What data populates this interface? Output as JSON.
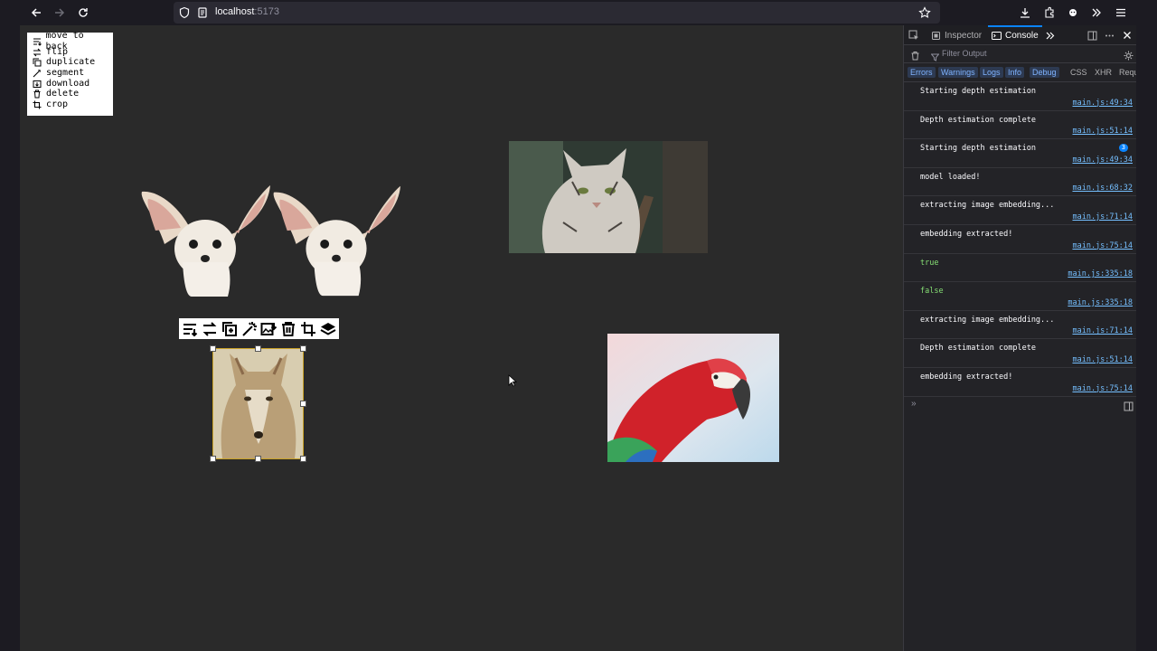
{
  "browser": {
    "url_host": "localhost",
    "url_port": ":5173"
  },
  "context_menu": {
    "items": [
      {
        "label": "move to back",
        "icon": "move-to-back-icon"
      },
      {
        "label": "flip",
        "icon": "flip-icon"
      },
      {
        "label": "duplicate",
        "icon": "duplicate-icon"
      },
      {
        "label": "segment",
        "icon": "segment-wand-icon"
      },
      {
        "label": "download",
        "icon": "download-icon"
      },
      {
        "label": "delete",
        "icon": "trash-icon"
      },
      {
        "label": "crop",
        "icon": "crop-icon"
      }
    ]
  },
  "selection_toolbar": {
    "tools": [
      "move-to-back-icon",
      "flip-icon",
      "duplicate-icon",
      "segment-wand-icon",
      "download-icon",
      "trash-icon",
      "crop-icon",
      "layers-icon"
    ]
  },
  "canvas": {
    "images": [
      "fennec-fox-1",
      "fennec-fox-2",
      "bobcat",
      "coyote",
      "macaw-parrot"
    ]
  },
  "devtools": {
    "tabs": {
      "inspector": "Inspector",
      "console": "Console"
    },
    "filter_placeholder": "Filter Output",
    "levels": [
      "Errors",
      "Warnings",
      "Logs",
      "Info",
      "Debug"
    ],
    "extra_filters": [
      "CSS",
      "XHR",
      "Requ"
    ],
    "logs": [
      {
        "message": "Starting depth estimation",
        "source": "main.js:49:34"
      },
      {
        "message": "Depth estimation complete",
        "source": "main.js:51:14"
      },
      {
        "message": "Starting depth estimation",
        "source": "main.js:49:34",
        "count": "3"
      },
      {
        "message": "model loaded!",
        "source": "main.js:68:32"
      },
      {
        "message": "extracting image embedding...",
        "source": "main.js:71:14"
      },
      {
        "message": "embedding extracted!",
        "source": "main.js:75:14"
      },
      {
        "message": "true",
        "source": "main.js:335:18",
        "bool": true
      },
      {
        "message": "false",
        "source": "main.js:335:18",
        "bool": true
      },
      {
        "message": "extracting image embedding...",
        "source": "main.js:71:14"
      },
      {
        "message": "Depth estimation complete",
        "source": "main.js:51:14"
      },
      {
        "message": "embedding extracted!",
        "source": "main.js:75:14"
      }
    ]
  },
  "colors": {
    "selection_border": "#c9a227",
    "console_link": "#75bfff",
    "accent": "#0a84ff"
  }
}
